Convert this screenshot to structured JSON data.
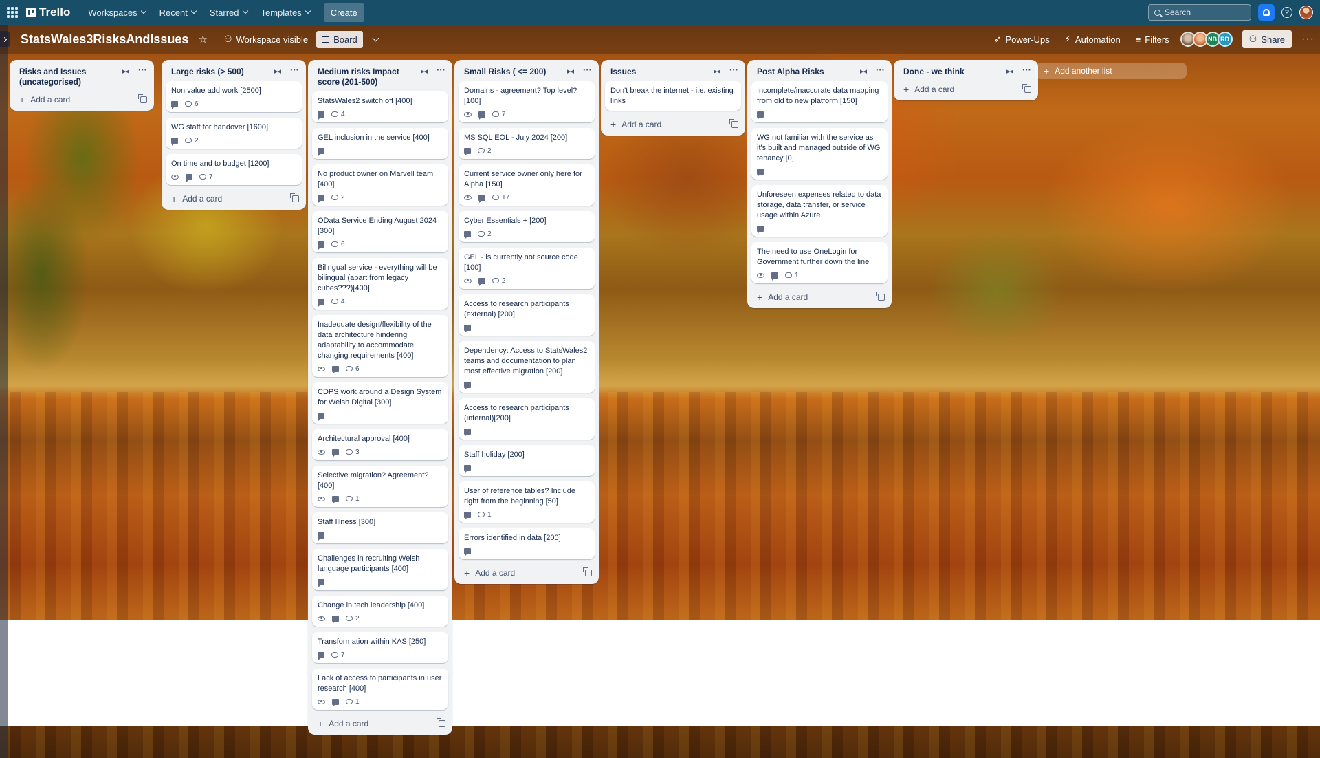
{
  "topnav": {
    "logo": "Trello",
    "menu": [
      {
        "label": "Workspaces"
      },
      {
        "label": "Recent"
      },
      {
        "label": "Starred"
      },
      {
        "label": "Templates"
      }
    ],
    "create_label": "Create",
    "search_placeholder": "Search",
    "help_glyph": "?"
  },
  "board_header": {
    "title": "StatsWales3RisksAndIssues",
    "visibility_label": "Workspace visible",
    "view_label": "Board",
    "powerups_label": "Power-Ups",
    "automation_label": "Automation",
    "filters_label": "Filters",
    "share_label": "Share",
    "member_initials": [
      "NB",
      "RD"
    ]
  },
  "add_card_label": "Add a card",
  "add_list_label": "Add another list",
  "lists": [
    {
      "title": "Risks and Issues (uncategorised)",
      "cards": []
    },
    {
      "title": "Large risks (> 500)",
      "cards": [
        {
          "text": "Non value add work [2500]",
          "watch": false,
          "desc": true,
          "comments": "6"
        },
        {
          "text": "WG staff for handover [1600]",
          "watch": false,
          "desc": true,
          "comments": "2"
        },
        {
          "text": "On time and to budget [1200]",
          "watch": true,
          "desc": true,
          "comments": "7"
        }
      ]
    },
    {
      "title": "Medium risks Impact score (201-500)",
      "cards": [
        {
          "text": "StatsWales2 switch off [400]",
          "watch": false,
          "desc": true,
          "comments": "4"
        },
        {
          "text": "GEL inclusion in the service [400]",
          "watch": false,
          "desc": true,
          "comments": ""
        },
        {
          "text": "No product owner on Marvell team [400]",
          "watch": false,
          "desc": true,
          "comments": "2"
        },
        {
          "text": "OData Service Ending August 2024 [300]",
          "watch": false,
          "desc": true,
          "comments": "6"
        },
        {
          "text": "Bilingual service - everything will be bilingual (apart from legacy cubes???)[400]",
          "watch": false,
          "desc": true,
          "comments": "4"
        },
        {
          "text": "Inadequate design/flexibility of the data architecture hindering adaptability to accommodate changing requirements [400]",
          "watch": true,
          "desc": true,
          "comments": "6"
        },
        {
          "text": "CDPS work around a Design System for Welsh Digital [300]",
          "watch": false,
          "desc": true,
          "comments": ""
        },
        {
          "text": "Architectural approval [400]",
          "watch": true,
          "desc": true,
          "comments": "3"
        },
        {
          "text": "Selective migration? Agreement? [400]",
          "watch": true,
          "desc": true,
          "comments": "1"
        },
        {
          "text": "Staff Illness [300]",
          "watch": false,
          "desc": true,
          "comments": ""
        },
        {
          "text": "Challenges in recruiting Welsh language participants [400]",
          "watch": false,
          "desc": true,
          "comments": ""
        },
        {
          "text": "Change in tech leadership [400]",
          "watch": true,
          "desc": true,
          "comments": "2"
        },
        {
          "text": "Transformation within KAS [250]",
          "watch": false,
          "desc": true,
          "comments": "7"
        },
        {
          "text": "Lack of access to participants in user research [400]",
          "watch": true,
          "desc": true,
          "comments": "1"
        }
      ]
    },
    {
      "title": "Small Risks ( <= 200)",
      "cards": [
        {
          "text": "Domains - agreement? Top level? [100]",
          "watch": true,
          "desc": true,
          "comments": "7"
        },
        {
          "text": "MS SQL EOL - July 2024 [200]",
          "watch": false,
          "desc": true,
          "comments": "2"
        },
        {
          "text": "Current service owner only here for Alpha [150]",
          "watch": true,
          "desc": true,
          "comments": "17"
        },
        {
          "text": "Cyber Essentials + [200]",
          "watch": false,
          "desc": true,
          "comments": "2"
        },
        {
          "text": "GEL - is currently not source code [100]",
          "watch": true,
          "desc": true,
          "comments": "2"
        },
        {
          "text": "Access to research participants (external) [200]",
          "watch": false,
          "desc": true,
          "comments": ""
        },
        {
          "text": "Dependency: Access to StatsWales2 teams and documentation to plan most effective migration [200]",
          "watch": false,
          "desc": true,
          "comments": ""
        },
        {
          "text": "Access to research participants (internal)[200]",
          "watch": false,
          "desc": true,
          "comments": ""
        },
        {
          "text": "Staff holiday [200]",
          "watch": false,
          "desc": true,
          "comments": ""
        },
        {
          "text": "User of reference tables? Include right from the beginning [50]",
          "watch": false,
          "desc": true,
          "comments": "1"
        },
        {
          "text": "Errors identified in data [200]",
          "watch": false,
          "desc": true,
          "comments": ""
        }
      ]
    },
    {
      "title": "Issues",
      "cards": [
        {
          "text": "Don't break the internet - i.e. existing links",
          "watch": false,
          "desc": false,
          "comments": ""
        }
      ]
    },
    {
      "title": "Post Alpha Risks",
      "cards": [
        {
          "text": "Incomplete/inaccurate data mapping from old to new platform [150]",
          "watch": false,
          "desc": true,
          "comments": ""
        },
        {
          "text": "WG not familiar with the service as it's built and managed outside of WG tenancy [0]",
          "watch": false,
          "desc": true,
          "comments": ""
        },
        {
          "text": "Unforeseen expenses related to data storage, data transfer, or service usage within Azure",
          "watch": false,
          "desc": true,
          "comments": ""
        },
        {
          "text": "The need to use OneLogin for Government further down the line",
          "watch": true,
          "desc": true,
          "comments": "1"
        }
      ]
    },
    {
      "title": "Done - we think",
      "cards": []
    }
  ]
}
